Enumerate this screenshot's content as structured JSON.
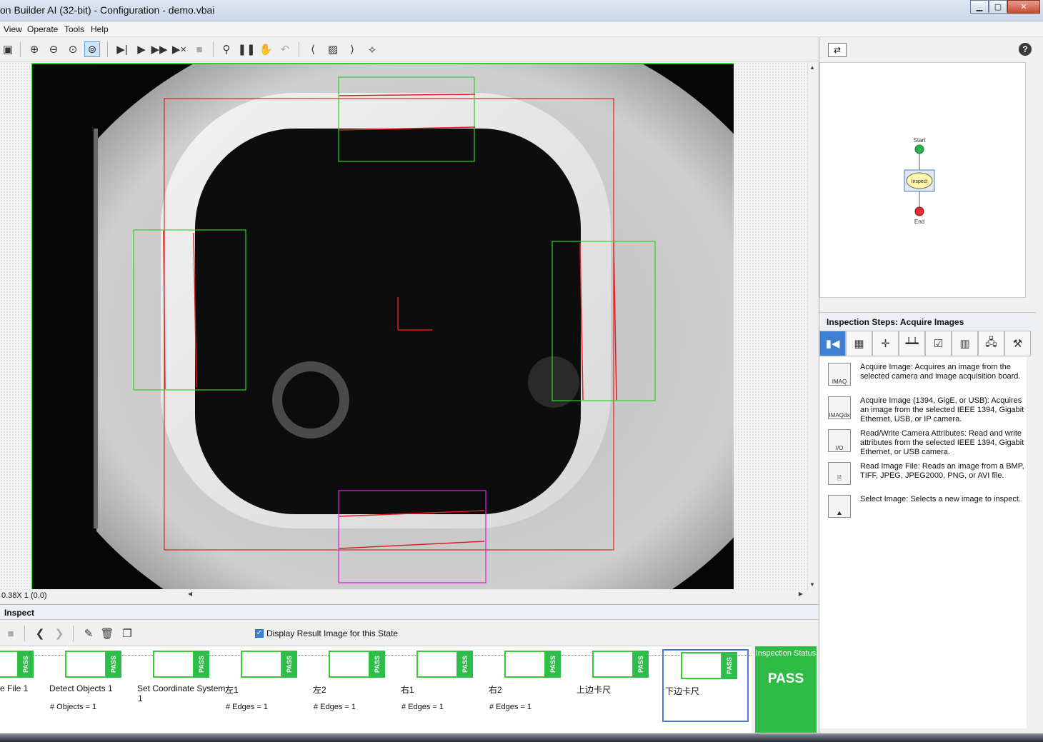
{
  "window": {
    "title": "on Builder AI (32-bit) - Configuration - demo.vbai",
    "minimize": "▁",
    "maximize": "▢",
    "close": "✕"
  },
  "menu": [
    "View",
    "Operate",
    "Tools",
    "Help"
  ],
  "toolbar": {
    "icons": [
      "save-icon",
      "zoom-in-icon",
      "zoom-out-icon",
      "zoom-fit-icon",
      "zoom-actual-icon",
      "step-icon",
      "run-icon",
      "run-continuous-icon",
      "stop-step-icon",
      "stop-icon",
      "marker-icon",
      "pause-icon",
      "hand-icon",
      "undo-icon",
      "left-arrow-icon",
      "image-icon",
      "right-arrow-icon",
      "measure-icon"
    ],
    "glyphs": [
      "▣",
      "⊕",
      "⊖",
      "⊙",
      "⊚",
      "▶|",
      "▶",
      "▶▶",
      "▶×",
      "■",
      "⚲",
      "❚❚",
      "✋",
      "↶",
      "⟨",
      "▨",
      "⟩",
      "⟡"
    ]
  },
  "viewer": {
    "zoom_info": "0.38X 1   (0,0)"
  },
  "inspect": {
    "header": "Inspect",
    "display_result_label": "Display Result Image for this State",
    "display_result_checked": true
  },
  "steps": [
    {
      "label": "e File 1",
      "result": ""
    },
    {
      "label": "Detect Objects 1",
      "result": "# Objects = 1"
    },
    {
      "label": "Set Coordinate System",
      "label2": "1",
      "result": ""
    },
    {
      "label": "左1",
      "result": "# Edges = 1"
    },
    {
      "label": "左2",
      "result": "# Edges = 1"
    },
    {
      "label": "右1",
      "result": "# Edges = 1"
    },
    {
      "label": "右2",
      "result": "# Edges = 1"
    },
    {
      "label": "上边卡尺",
      "result": ""
    },
    {
      "label": "下边卡尺",
      "result": ""
    }
  ],
  "pass_label": "PASS",
  "status": {
    "title": "Inspection Status",
    "value": "PASS"
  },
  "flow": {
    "start": "Start",
    "inspect": "Inspect",
    "end": "End"
  },
  "inspection_steps": {
    "title": "Inspection Steps: Acquire Images",
    "tabs": [
      "acquire-icon",
      "enhance-icon",
      "locate-icon",
      "measure-icon",
      "check-icon",
      "identify-icon",
      "communicate-icon",
      "tools-icon"
    ],
    "tab_glyphs": [
      "▮◀",
      "▦",
      "✛",
      "┷┷",
      "☑",
      "▥",
      "🖧",
      "⚒"
    ],
    "items": [
      {
        "icon": "IMAQ",
        "text": "Acquire Image:  Acquires an image from the selected camera and image acquisition board."
      },
      {
        "icon": "IMAQdx",
        "text": "Acquire Image (1394, GigE, or USB):  Acquires an image from the selected IEEE 1394, Gigabit Ethernet, USB, or IP camera."
      },
      {
        "icon": "I/O",
        "text": "Read/Write Camera Attributes:  Read and write attributes from the selected IEEE 1394, Gigabit Ethernet, or USB camera."
      },
      {
        "icon": "",
        "text": "Read Image File:  Reads an image from a BMP, TIFF, JPEG, JPEG2000, PNG, or AVI file."
      },
      {
        "icon": "",
        "text": "Select Image:  Selects a new image to inspect."
      }
    ]
  },
  "help": "?"
}
